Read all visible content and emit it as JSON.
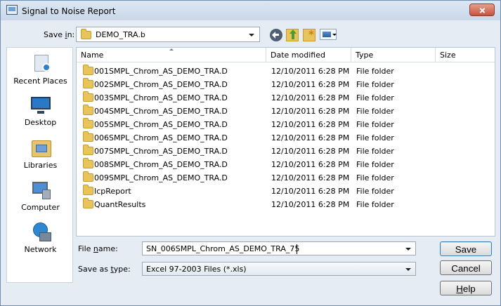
{
  "window": {
    "title": "Signal to Noise Report"
  },
  "save_in": {
    "label_before": "Save ",
    "label_underlined": "i",
    "label_after": "n:",
    "current_folder": "DEMO_TRA.b"
  },
  "toolbar": {
    "back": "back-icon",
    "up": "up-folder-icon",
    "new_folder": "new-folder-icon",
    "views": "views-menu-icon"
  },
  "places": [
    {
      "label": "Recent Places",
      "icon": "recent-places-icon"
    },
    {
      "label": "Desktop",
      "icon": "desktop-icon"
    },
    {
      "label": "Libraries",
      "icon": "libraries-icon"
    },
    {
      "label": "Computer",
      "icon": "computer-icon"
    },
    {
      "label": "Network",
      "icon": "network-icon"
    }
  ],
  "file_list": {
    "columns": [
      "Name",
      "Date modified",
      "Type",
      "Size"
    ],
    "rows": [
      {
        "name": "001SMPL_Chrom_AS_DEMO_TRA.D",
        "date": "12/10/2011 6:28 PM",
        "type": "File folder",
        "size": ""
      },
      {
        "name": "002SMPL_Chrom_AS_DEMO_TRA.D",
        "date": "12/10/2011 6:28 PM",
        "type": "File folder",
        "size": ""
      },
      {
        "name": "003SMPL_Chrom_AS_DEMO_TRA.D",
        "date": "12/10/2011 6:28 PM",
        "type": "File folder",
        "size": ""
      },
      {
        "name": "004SMPL_Chrom_AS_DEMO_TRA.D",
        "date": "12/10/2011 6:28 PM",
        "type": "File folder",
        "size": ""
      },
      {
        "name": "005SMPL_Chrom_AS_DEMO_TRA.D",
        "date": "12/10/2011 6:28 PM",
        "type": "File folder",
        "size": ""
      },
      {
        "name": "006SMPL_Chrom_AS_DEMO_TRA.D",
        "date": "12/10/2011 6:28 PM",
        "type": "File folder",
        "size": ""
      },
      {
        "name": "007SMPL_Chrom_AS_DEMO_TRA.D",
        "date": "12/10/2011 6:28 PM",
        "type": "File folder",
        "size": ""
      },
      {
        "name": "008SMPL_Chrom_AS_DEMO_TRA.D",
        "date": "12/10/2011 6:28 PM",
        "type": "File folder",
        "size": ""
      },
      {
        "name": "009SMPL_Chrom_AS_DEMO_TRA.D",
        "date": "12/10/2011 6:28 PM",
        "type": "File folder",
        "size": ""
      },
      {
        "name": "IcpReport",
        "date": "12/10/2011 6:28 PM",
        "type": "File folder",
        "size": ""
      },
      {
        "name": "QuantResults",
        "date": "12/10/2011 6:28 PM",
        "type": "File folder",
        "size": ""
      }
    ]
  },
  "file_name": {
    "label_before": "File ",
    "label_underlined": "n",
    "label_after": "ame:",
    "value": "SN_006SMPL_Chrom_AS_DEMO_TRA_75"
  },
  "save_as_type": {
    "label_before": "Save as ",
    "label_underlined": "t",
    "label_after": "ype:",
    "value": "Excel 97-2003 Files (*.xls)"
  },
  "buttons": {
    "save": "Save",
    "cancel": "Cancel",
    "help_underlined": "H",
    "help_rest": "elp"
  }
}
